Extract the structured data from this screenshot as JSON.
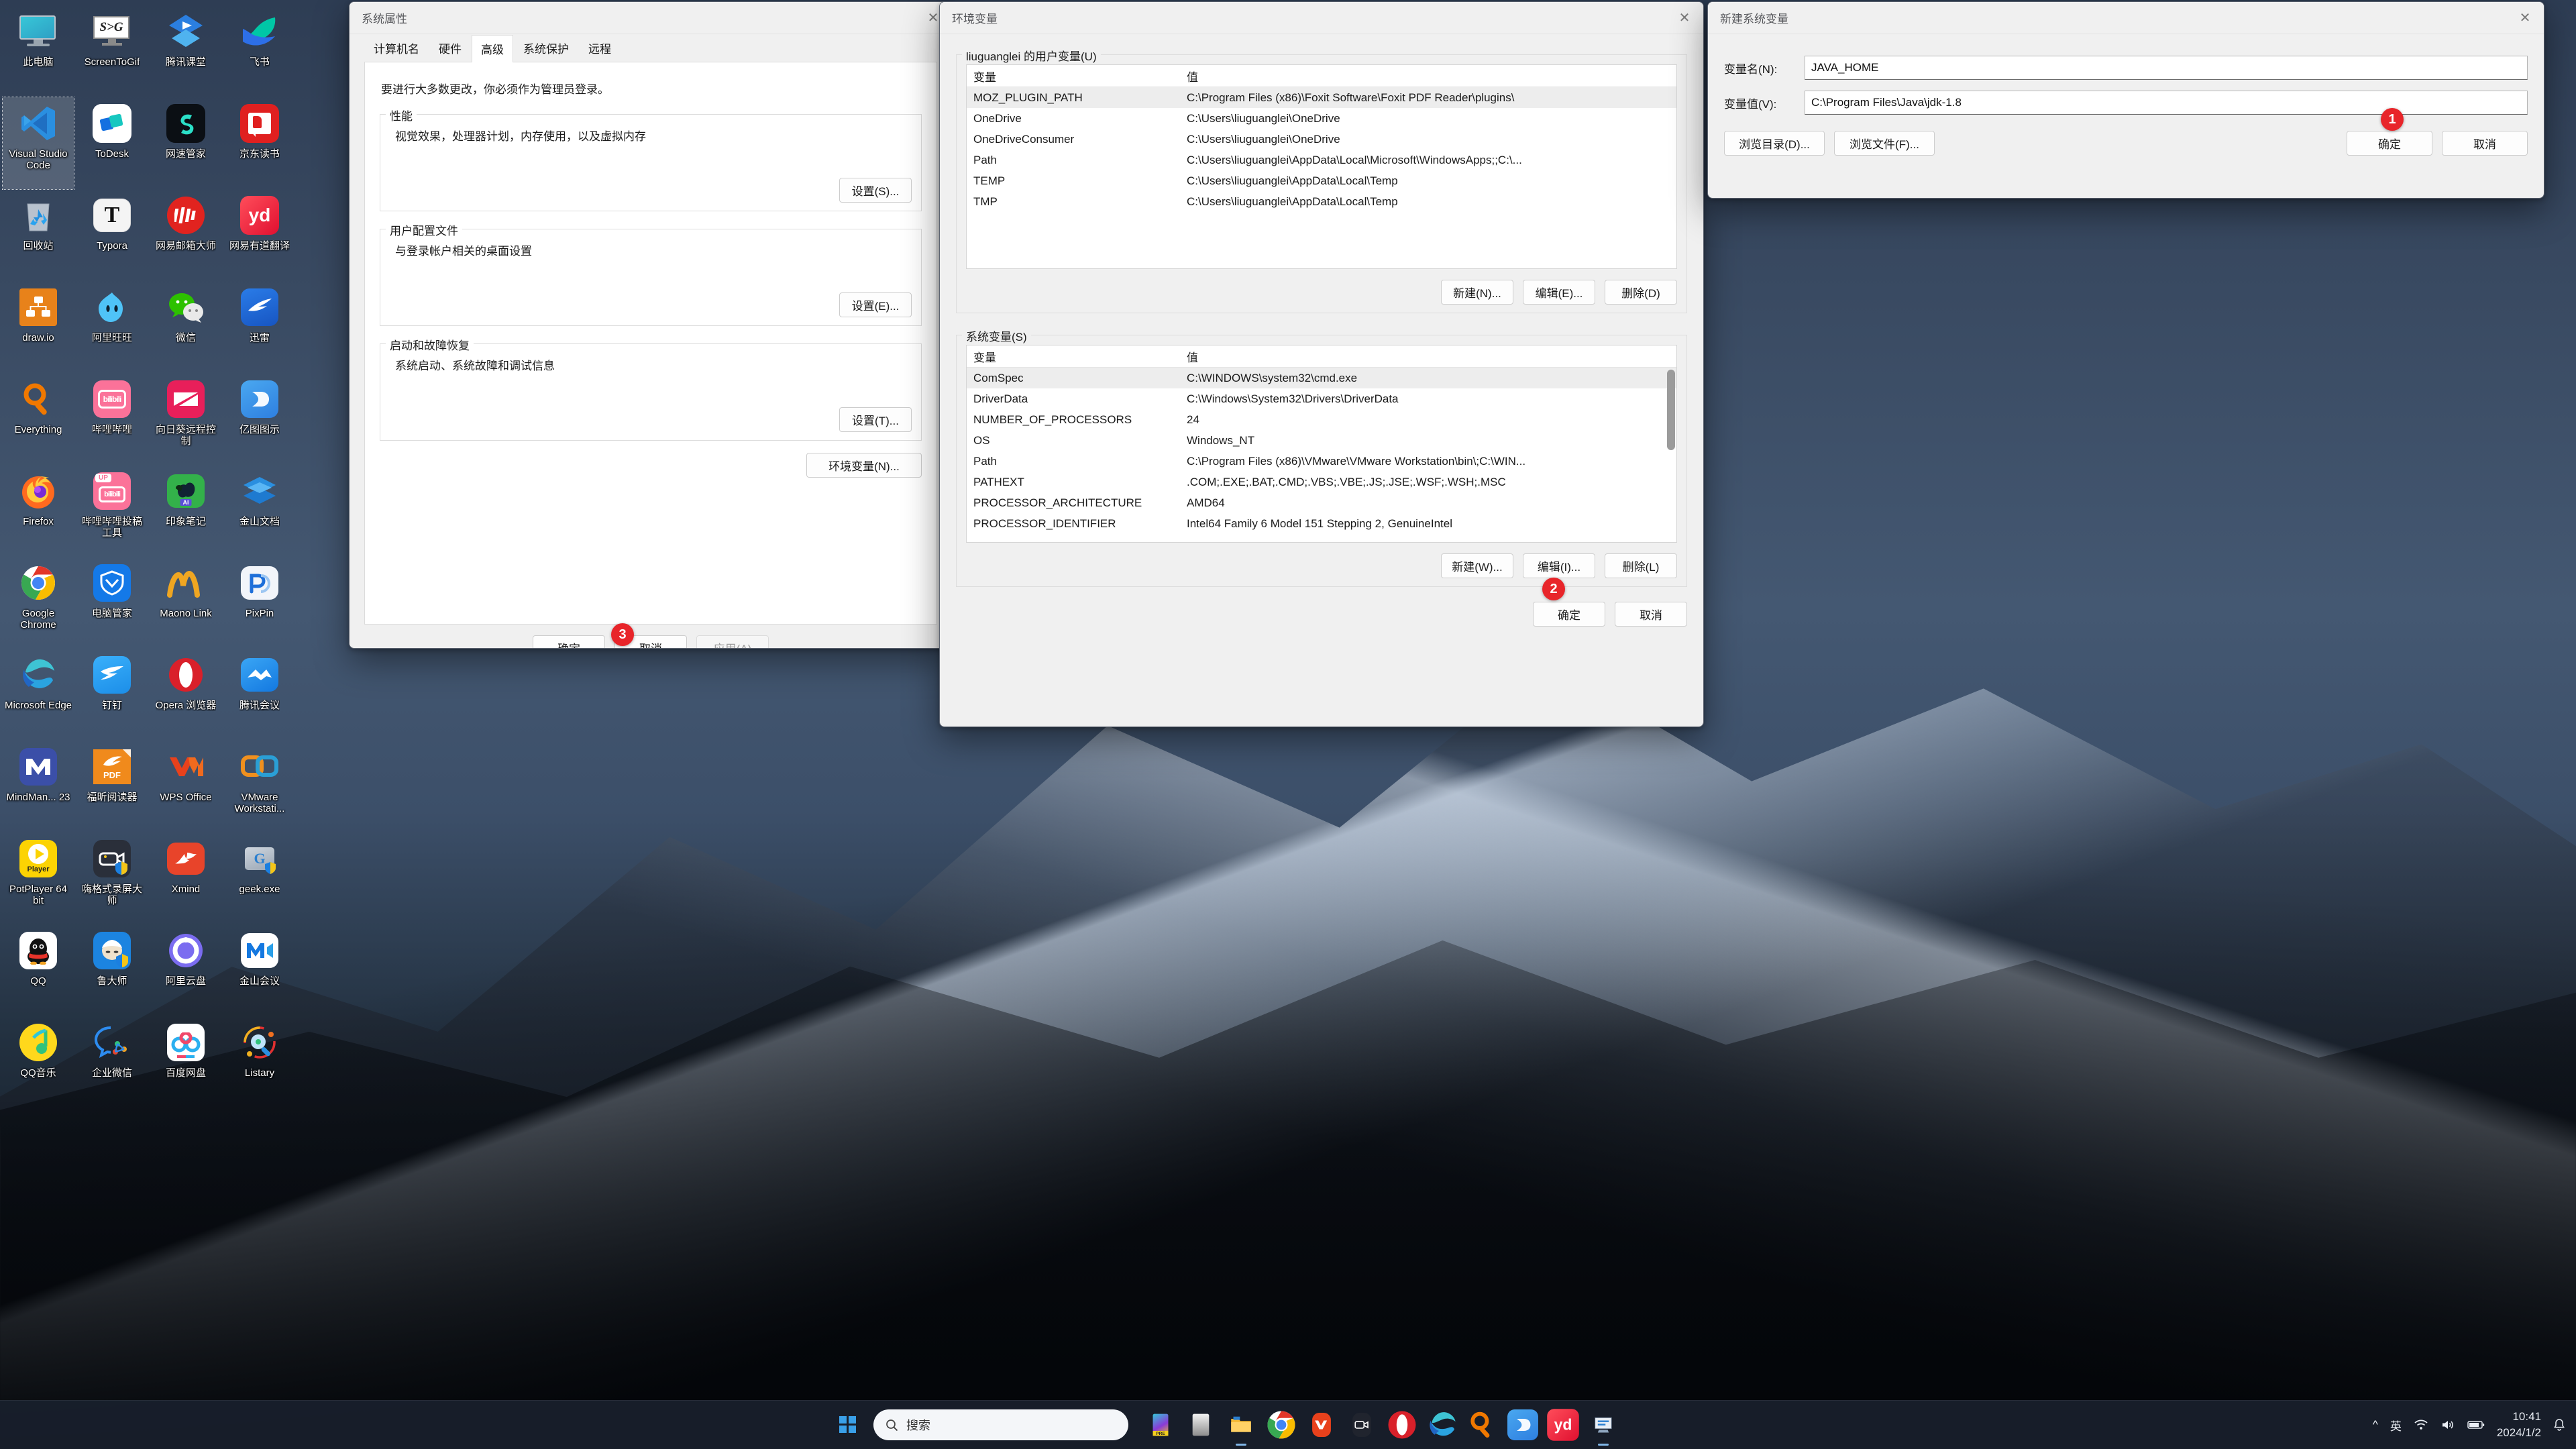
{
  "desktop": {
    "icons": [
      {
        "label": "此电脑",
        "icon": "this-pc-icon"
      },
      {
        "label": "ScreenToGif",
        "icon": "screentogif-icon"
      },
      {
        "label": "腾讯课堂",
        "icon": "tencent-classroom-icon"
      },
      {
        "label": "飞书",
        "icon": "feishu-icon"
      },
      {
        "label": "Visual Studio Code",
        "icon": "vscode-icon",
        "selected": true
      },
      {
        "label": "ToDesk",
        "icon": "todesk-icon"
      },
      {
        "label": "网速管家",
        "icon": "netspeed-manager-icon"
      },
      {
        "label": "京东读书",
        "icon": "jd-read-icon"
      },
      {
        "label": "回收站",
        "icon": "recycle-bin-icon"
      },
      {
        "label": "Typora",
        "icon": "typora-icon"
      },
      {
        "label": "网易邮箱大师",
        "icon": "netease-mail-icon"
      },
      {
        "label": "网易有道翻译",
        "icon": "youdao-translate-icon"
      },
      {
        "label": "draw.io",
        "icon": "drawio-icon"
      },
      {
        "label": "阿里旺旺",
        "icon": "aliwangwang-icon"
      },
      {
        "label": "微信",
        "icon": "wechat-icon"
      },
      {
        "label": "迅雷",
        "icon": "xunlei-icon"
      },
      {
        "label": "Everything",
        "icon": "everything-icon"
      },
      {
        "label": "哔哩哔哩",
        "icon": "bilibili-icon"
      },
      {
        "label": "向日葵远程控制",
        "icon": "sunlogin-icon"
      },
      {
        "label": "亿图图示",
        "icon": "edraw-icon"
      },
      {
        "label": "Firefox",
        "icon": "firefox-icon"
      },
      {
        "label": "哔哩哔哩投稿工具",
        "icon": "bilibili-upload-icon"
      },
      {
        "label": "印象笔记",
        "icon": "evernote-icon"
      },
      {
        "label": "金山文档",
        "icon": "kingsoft-docs-icon"
      },
      {
        "label": "Google Chrome",
        "icon": "chrome-icon"
      },
      {
        "label": "电脑管家",
        "icon": "pc-manager-icon"
      },
      {
        "label": "Maono Link",
        "icon": "maono-link-icon"
      },
      {
        "label": "PixPin",
        "icon": "pixpin-icon"
      },
      {
        "label": "Microsoft Edge",
        "icon": "edge-icon"
      },
      {
        "label": "钉钉",
        "icon": "dingtalk-icon"
      },
      {
        "label": "Opera 浏览器",
        "icon": "opera-icon"
      },
      {
        "label": "腾讯会议",
        "icon": "tencent-meeting-icon"
      },
      {
        "label": "MindMan... 23",
        "icon": "mindmanager-icon"
      },
      {
        "label": "福昕阅读器",
        "icon": "foxit-reader-icon"
      },
      {
        "label": "WPS Office",
        "icon": "wps-office-icon"
      },
      {
        "label": "VMware Workstati...",
        "icon": "vmware-workstation-icon"
      },
      {
        "label": "PotPlayer 64 bit",
        "icon": "potplayer-icon"
      },
      {
        "label": "嗨格式录屏大师",
        "icon": "higeshi-recorder-icon"
      },
      {
        "label": "Xmind",
        "icon": "xmind-icon"
      },
      {
        "label": "geek.exe",
        "icon": "geek-uninstaller-icon"
      },
      {
        "label": "QQ",
        "icon": "qq-icon"
      },
      {
        "label": "鲁大师",
        "icon": "ludashi-icon"
      },
      {
        "label": "阿里云盘",
        "icon": "aliyun-drive-icon"
      },
      {
        "label": "金山会议",
        "icon": "kingsoft-meeting-icon"
      },
      {
        "label": "QQ音乐",
        "icon": "qq-music-icon"
      },
      {
        "label": "企业微信",
        "icon": "wecom-icon"
      },
      {
        "label": "百度网盘",
        "icon": "baidu-netdisk-icon"
      },
      {
        "label": "Listary",
        "icon": "listary-icon"
      }
    ]
  },
  "system_properties": {
    "title": "系统属性",
    "close_label": "✕",
    "tabs": [
      {
        "label": "计算机名",
        "active": false
      },
      {
        "label": "硬件",
        "active": false
      },
      {
        "label": "高级",
        "active": true
      },
      {
        "label": "系统保护",
        "active": false
      },
      {
        "label": "远程",
        "active": false
      }
    ],
    "admin_note": "要进行大多数更改，你必须作为管理员登录。",
    "groups": [
      {
        "legend": "性能",
        "desc": "视觉效果，处理器计划，内存使用，以及虚拟内存",
        "button": "设置(S)..."
      },
      {
        "legend": "用户配置文件",
        "desc": "与登录帐户相关的桌面设置",
        "button": "设置(E)..."
      },
      {
        "legend": "启动和故障恢复",
        "desc": "系统启动、系统故障和调试信息",
        "button": "设置(T)..."
      }
    ],
    "env_button": "环境变量(N)...",
    "ok_label": "确定",
    "cancel_label": "取消",
    "apply_label": "应用(A)",
    "step_badge": "3"
  },
  "environment_variables": {
    "title": "环境变量",
    "close_label": "✕",
    "user_section_label": "liuguanglei 的用户变量(U)",
    "system_section_label": "系统变量(S)",
    "columns": {
      "variable": "变量",
      "value": "值"
    },
    "user_rows": [
      {
        "variable": "MOZ_PLUGIN_PATH",
        "value": "C:\\Program Files (x86)\\Foxit Software\\Foxit PDF Reader\\plugins\\",
        "selected": true
      },
      {
        "variable": "OneDrive",
        "value": "C:\\Users\\liuguanglei\\OneDrive",
        "selected": false
      },
      {
        "variable": "OneDriveConsumer",
        "value": "C:\\Users\\liuguanglei\\OneDrive",
        "selected": false
      },
      {
        "variable": "Path",
        "value": "C:\\Users\\liuguanglei\\AppData\\Local\\Microsoft\\WindowsApps;;C:\\...",
        "selected": false
      },
      {
        "variable": "TEMP",
        "value": "C:\\Users\\liuguanglei\\AppData\\Local\\Temp",
        "selected": false
      },
      {
        "variable": "TMP",
        "value": "C:\\Users\\liuguanglei\\AppData\\Local\\Temp",
        "selected": false
      }
    ],
    "user_buttons": {
      "new": "新建(N)...",
      "edit": "编辑(E)...",
      "delete": "删除(D)"
    },
    "system_rows": [
      {
        "variable": "ComSpec",
        "value": "C:\\WINDOWS\\system32\\cmd.exe",
        "selected": true
      },
      {
        "variable": "DriverData",
        "value": "C:\\Windows\\System32\\Drivers\\DriverData",
        "selected": false
      },
      {
        "variable": "NUMBER_OF_PROCESSORS",
        "value": "24",
        "selected": false
      },
      {
        "variable": "OS",
        "value": "Windows_NT",
        "selected": false
      },
      {
        "variable": "Path",
        "value": "C:\\Program Files (x86)\\VMware\\VMware Workstation\\bin\\;C:\\WIN...",
        "selected": false
      },
      {
        "variable": "PATHEXT",
        "value": ".COM;.EXE;.BAT;.CMD;.VBS;.VBE;.JS;.JSE;.WSF;.WSH;.MSC",
        "selected": false
      },
      {
        "variable": "PROCESSOR_ARCHITECTURE",
        "value": "AMD64",
        "selected": false
      },
      {
        "variable": "PROCESSOR_IDENTIFIER",
        "value": "Intel64 Family 6 Model 151 Stepping 2, GenuineIntel",
        "selected": false
      }
    ],
    "system_buttons": {
      "new": "新建(W)...",
      "edit": "编辑(I)...",
      "delete": "删除(L)"
    },
    "ok_label": "确定",
    "cancel_label": "取消",
    "step_badge": "2"
  },
  "new_system_variable": {
    "title": "新建系统变量",
    "close_label": "✕",
    "name_label": "变量名(N):",
    "name_value": "JAVA_HOME",
    "value_label": "变量值(V):",
    "value_value": "C:\\Program Files\\Java\\jdk-1.8",
    "browse_dir_label": "浏览目录(D)...",
    "browse_file_label": "浏览文件(F)...",
    "ok_label": "确定",
    "cancel_label": "取消",
    "step_badge": "1"
  },
  "taskbar": {
    "search_placeholder": "搜索",
    "start_icon": "windows-start-icon",
    "apps": [
      {
        "name": "pre-icon"
      },
      {
        "name": "task-view-icon"
      },
      {
        "name": "file-explorer-icon"
      },
      {
        "name": "chrome-icon"
      },
      {
        "name": "wps-office-icon"
      },
      {
        "name": "screen-recorder-icon"
      },
      {
        "name": "opera-icon"
      },
      {
        "name": "edge-icon"
      },
      {
        "name": "everything-icon"
      },
      {
        "name": "edraw-icon"
      },
      {
        "name": "youdao-translate-icon"
      },
      {
        "name": "system-properties-icon"
      }
    ],
    "tray": {
      "chevron": "^",
      "ime_label": "英",
      "wifi_icon": "wifi-icon",
      "volume_icon": "volume-icon",
      "battery_icon": "battery-icon",
      "time": "10:41",
      "date": "2024/1/2",
      "notification_icon": "bell-icon"
    }
  },
  "colors": {
    "accent_red": "#e8252a",
    "window_bg": "#f0f0f0",
    "taskbar_bg": "#19202c"
  }
}
